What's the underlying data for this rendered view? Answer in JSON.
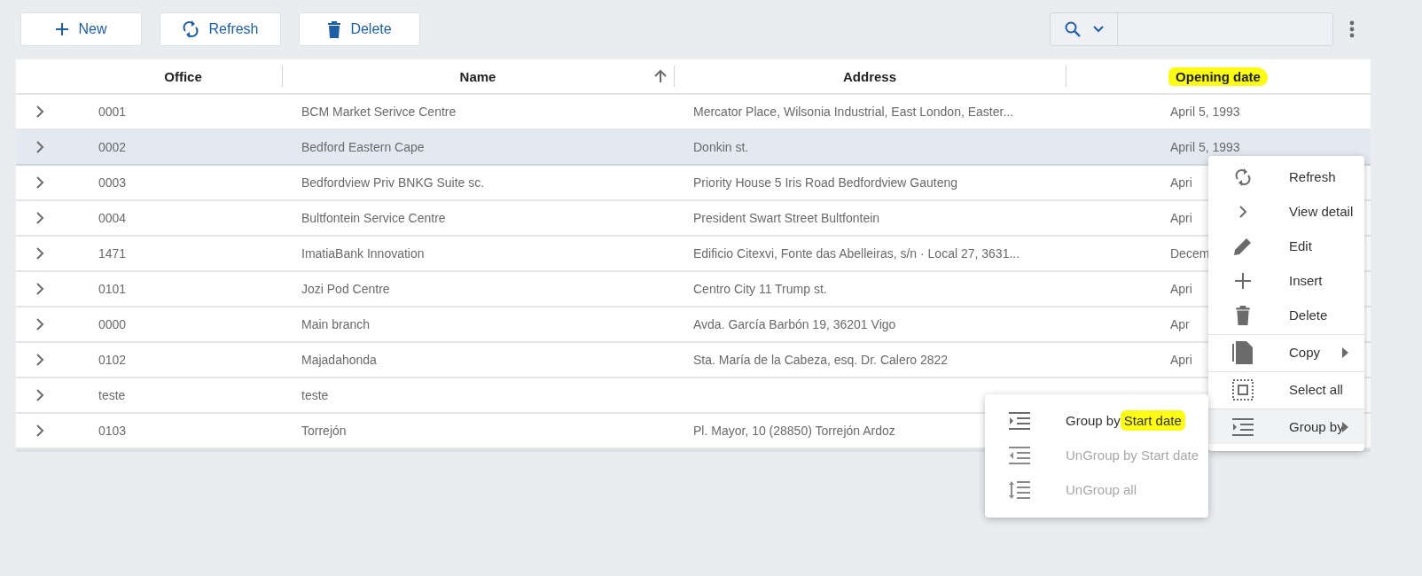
{
  "toolbar": {
    "buttons": [
      {
        "label": "New"
      },
      {
        "label": "Refresh"
      },
      {
        "label": "Delete"
      }
    ]
  },
  "table": {
    "columns": [
      {
        "label": "Office",
        "sorted": false,
        "highlighted": false
      },
      {
        "label": "Name",
        "sorted": true,
        "highlighted": false
      },
      {
        "label": "Address",
        "sorted": false,
        "highlighted": false
      },
      {
        "label": "Opening date",
        "sorted": false,
        "highlighted": true
      }
    ],
    "rows": [
      {
        "office": "0001",
        "name": "BCM Market Serivce Centre",
        "address": "Mercator Place, Wilsonia Industrial, East London, Easter...",
        "date": "April 5, 1993",
        "selected": false
      },
      {
        "office": "0002",
        "name": "Bedford Eastern Cape",
        "address": "Donkin st.",
        "date": "April 5, 1993",
        "selected": true
      },
      {
        "office": "0003",
        "name": "Bedfordview Priv BNKG Suite sc.",
        "address": "Priority House 5 Iris Road Bedfordview Gauteng",
        "date": "Apri",
        "selected": false
      },
      {
        "office": "0004",
        "name": "Bultfontein Service Centre",
        "address": "President Swart Street Bultfontein",
        "date": "Apri",
        "selected": false
      },
      {
        "office": "1471",
        "name": "ImatiaBank Innovation",
        "address": "Edificio Citexvi, Fonte das Abelleiras, s/n · Local 27, 3631...",
        "date": "Decem",
        "selected": false
      },
      {
        "office": "0101",
        "name": "Jozi Pod Centre",
        "address": "Centro City 11 Trump st.",
        "date": "Apri",
        "selected": false
      },
      {
        "office": "0000",
        "name": "Main branch",
        "address": "Avda. García Barbón 19, 36201 Vigo",
        "date": "Apr",
        "selected": false
      },
      {
        "office": "0102",
        "name": "Majadahonda",
        "address": "Sta. María de la Cabeza, esq. Dr. Calero 2822",
        "date": "Apri",
        "selected": false
      },
      {
        "office": "teste",
        "name": "teste",
        "selected": false
      },
      {
        "office": "0103",
        "name": "Torrejón",
        "address": "Pl. Mayor, 10 (28850) Torrejón Ardoz",
        "selected": false
      }
    ]
  },
  "context_menu": {
    "items": [
      {
        "label": "Refresh",
        "submenu": false,
        "divider_before": false,
        "selected": false
      },
      {
        "label": "View detail",
        "submenu": false,
        "divider_before": false,
        "selected": false
      },
      {
        "label": "Edit",
        "submenu": false,
        "divider_before": false,
        "selected": false
      },
      {
        "label": "Insert",
        "submenu": false,
        "divider_before": false,
        "selected": false
      },
      {
        "label": "Delete",
        "submenu": false,
        "divider_before": false,
        "selected": false
      },
      {
        "label": "Copy",
        "submenu": true,
        "divider_before": true,
        "selected": false
      },
      {
        "label": "Select all",
        "submenu": false,
        "divider_before": true,
        "selected": false
      },
      {
        "label": "Group by",
        "submenu": true,
        "divider_before": true,
        "selected": true
      }
    ]
  },
  "submenu": {
    "items": [
      {
        "label": "Group by",
        "highlight": "Start date",
        "disabled": false
      },
      {
        "label": "UnGroup by Start date",
        "disabled": true
      },
      {
        "label": "UnGroup all",
        "disabled": true
      }
    ]
  }
}
